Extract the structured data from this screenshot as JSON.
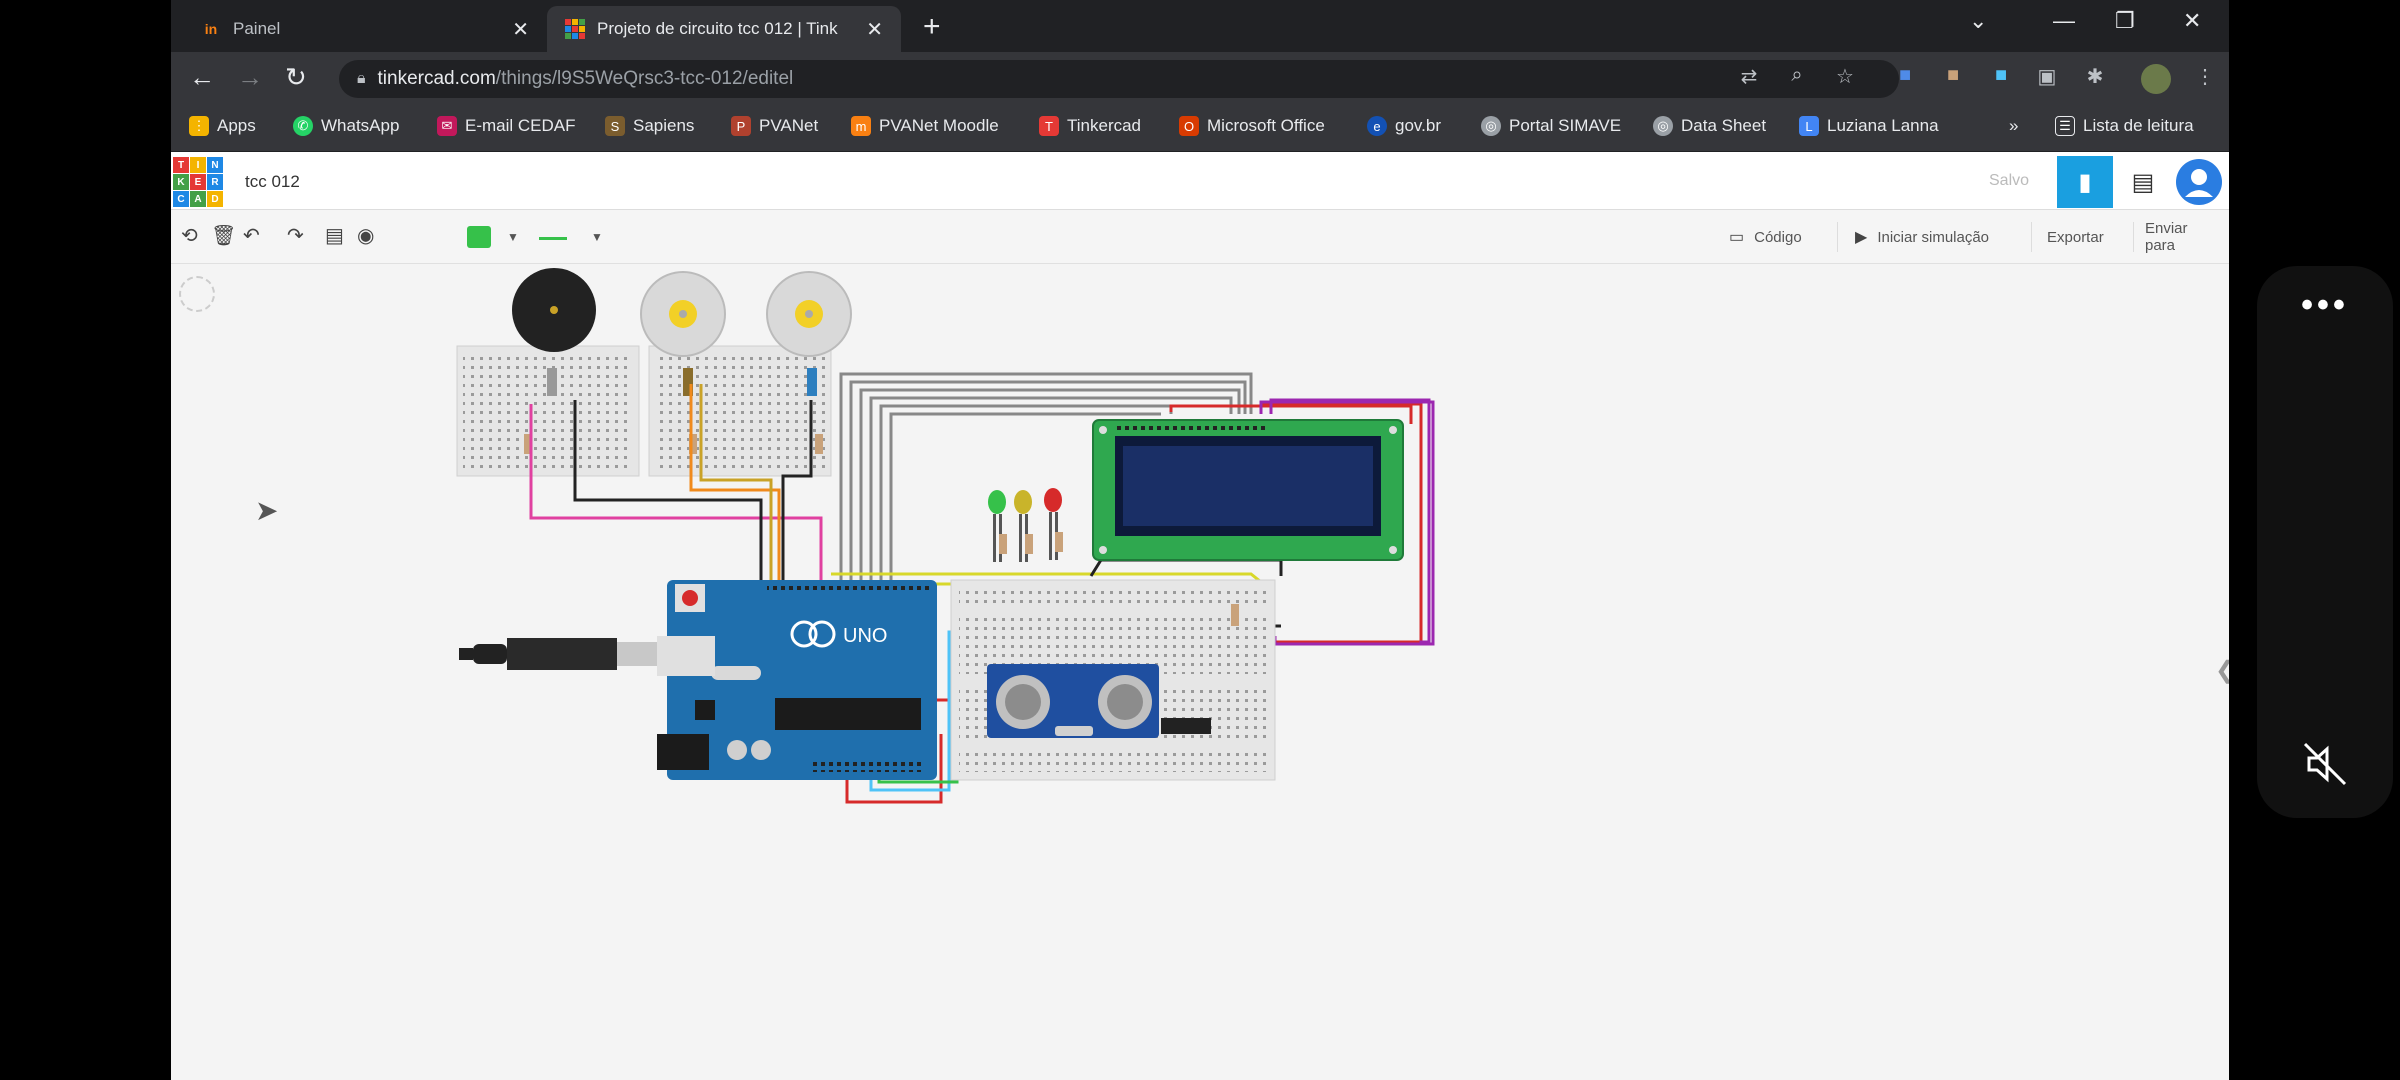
{
  "browser": {
    "tabs": [
      {
        "title": "Painel",
        "active": false
      },
      {
        "title": "Projeto de circuito tcc 012 | Tink",
        "active": true
      }
    ],
    "new_tab": "+",
    "window_controls": {
      "dropdown": "⌄",
      "minimize": "—",
      "restore": "❐",
      "close": "✕"
    },
    "url_host": "tinkercad.com",
    "url_path": "/things/l9S5WeQrsc3-tcc-012/editel",
    "bookmarks": [
      {
        "label": "Apps",
        "icon": "apps-grid-icon",
        "color": "#f4b400"
      },
      {
        "label": "WhatsApp",
        "icon": "whatsapp-icon",
        "color": "#25d366"
      },
      {
        "label": "E-mail CEDAF",
        "icon": "mail-icon",
        "color": "#c2185b"
      },
      {
        "label": "Sapiens",
        "icon": "sapiens-icon",
        "color": "#7b5d2e"
      },
      {
        "label": "PVANet",
        "icon": "pvanet-icon",
        "color": "#b0412e"
      },
      {
        "label": "PVANet Moodle",
        "icon": "moodle-icon",
        "color": "#f98012"
      },
      {
        "label": "Tinkercad",
        "icon": "tinkercad-icon",
        "color": "#e53935"
      },
      {
        "label": "Microsoft Office",
        "icon": "office-icon",
        "color": "#d83b01"
      },
      {
        "label": "gov.br",
        "icon": "govbr-icon",
        "color": "#1351b4"
      },
      {
        "label": "Portal SIMAVE",
        "icon": "globe-icon",
        "color": "#9aa0a6"
      },
      {
        "label": "Data Sheet",
        "icon": "globe-icon",
        "color": "#9aa0a6"
      },
      {
        "label": "Luziana Lanna",
        "icon": "l-icon",
        "color": "#4285f4"
      }
    ],
    "more_bookmarks": "»",
    "reading_list": "Lista de leitura"
  },
  "tinkercad": {
    "project_name": "tcc 012",
    "saved_label": "Salvo",
    "buttons": {
      "code": "Código",
      "start_simulation": "Iniciar simulação",
      "export": "Exportar",
      "send_to": "Enviar para"
    },
    "wire_color": "#36c14a"
  },
  "circuit": {
    "arduino_label": "UNO",
    "components": [
      "piezo-buzzer",
      "dc-motor",
      "dc-motor",
      "lcd-16x2",
      "led-green",
      "led-yellow",
      "led-red",
      "ultrasonic-sensor",
      "arduino-uno",
      "usb-cable",
      "breadboard-small",
      "breadboard-small",
      "breadboard-half"
    ]
  }
}
